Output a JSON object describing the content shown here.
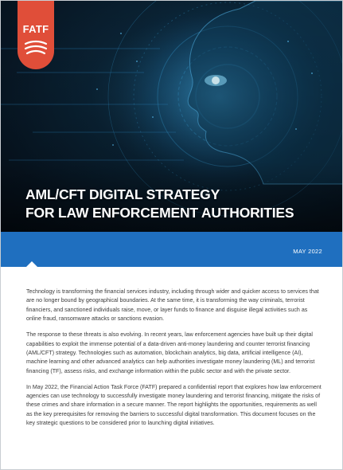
{
  "logo": {
    "text": "FATF"
  },
  "title": {
    "line1": "AML/CFT DIGITAL STRATEGY",
    "line2": "FOR LAW ENFORCEMENT AUTHORITIES"
  },
  "date": "MAY 2022",
  "paragraphs": [
    "Technology is transforming the financial services industry, including through wider and quicker access to services that are no longer bound by geographical boundaries.  At the same time, it is transforming the way criminals, terrorist financiers, and sanctioned individuals raise, move, or layer funds to finance and disguise illegal activities such as online fraud, ransomware attacks or sanctions evasion.",
    "The response to these threats is also evolving. In recent years, law enforcement agencies have built up their digital capabilities to exploit the immense potential of a data-driven anti-money laundering and counter terrorist financing (AML/CFT) strategy. Technologies such as automation, blockchain analytics, big data, artificial intelligence (AI), machine learning and other advanced analytics can help authorities investigate money laundering (ML) and terrorist financing (TF), assess risks, and exchange information within the public sector and with the private sector.",
    "In May 2022, the Financial Action Task Force (FATF) prepared a confidential report that explores how law enforcement agencies can use technology to successfully investigate money laundering and terrorist financing, mitigate the risks of these crimes and share information in a secure manner.  The report highlights the opportunities, requirements as well as the key prerequisites for removing the barriers to successful digital transformation. This document focuses on the key strategic questions to be considered prior to launching digital initiatives."
  ],
  "colors": {
    "logo": "#e04e39",
    "band": "#1f6fbf",
    "hero_dark": "#071522",
    "text": "#3b3b3b"
  }
}
